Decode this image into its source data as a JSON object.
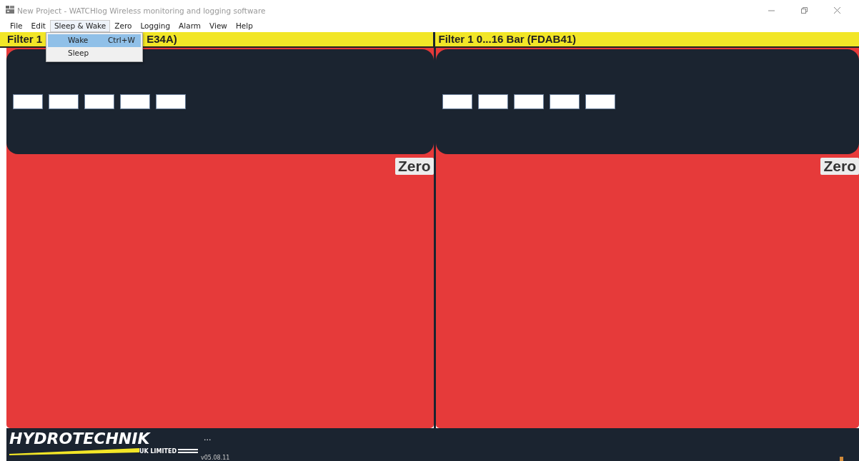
{
  "window": {
    "title": "New Project - WATCHlog Wireless monitoring and logging software"
  },
  "menu": [
    {
      "label": "File",
      "open": false
    },
    {
      "label": "Edit",
      "open": false
    },
    {
      "label": "Sleep & Wake",
      "open": true
    },
    {
      "label": "Zero",
      "open": false
    },
    {
      "label": "Logging",
      "open": false
    },
    {
      "label": "Alarm",
      "open": false
    },
    {
      "label": "View",
      "open": false
    },
    {
      "label": "Help",
      "open": false
    }
  ],
  "dropdown": [
    {
      "label": "Wake",
      "shortcut": "Ctrl+W",
      "selected": true
    },
    {
      "label": "Sleep",
      "selected": false
    }
  ],
  "panels": [
    {
      "title_start": "Filter 1",
      "title_end": "E34A)",
      "inputs": [
        {
          "kind": "text"
        },
        {
          "kind": "text"
        },
        {
          "kind": "text"
        },
        {
          "kind": "text"
        },
        {
          "kind": "text"
        }
      ],
      "zero_button": "Zero"
    },
    {
      "title_start": "Filter 1 0...16 Bar (FDAB41)",
      "inputs": [
        {
          "kind": "text"
        },
        {
          "kind": "text"
        },
        {
          "kind": "text"
        },
        {
          "kind": "text"
        },
        {
          "kind": "text"
        }
      ],
      "zero_button": "Zero"
    }
  ],
  "footer": {
    "logo": "HYDROTECHNIK",
    "logo_sub": "UK LIMITED",
    "status": "...",
    "version": "v05.08.11"
  }
}
